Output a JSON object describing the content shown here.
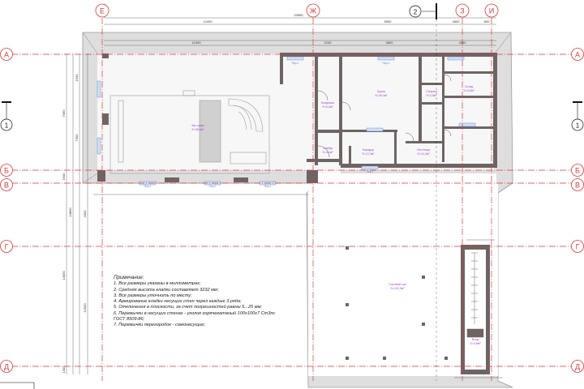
{
  "axes": {
    "vertical": [
      "Е",
      "Ж",
      "З",
      "И"
    ],
    "horizontal": [
      "А",
      "Б",
      "В",
      "Г",
      "Д"
    ],
    "numbered": [
      "1"
    ],
    "section_mark": "2"
  },
  "dimensions": {
    "top_overall": "23950",
    "top_chain": [
      "12400",
      "5950",
      "4800",
      "800"
    ],
    "top_sub": [
      "12400",
      "2240",
      "4800",
      "4530"
    ],
    "left_chain": [
      "7060",
      "1900",
      "14000",
      "1300"
    ],
    "left_overall": "24860",
    "left_sub": [
      "1530",
      "7300",
      "2000",
      "12000"
    ]
  },
  "rooms": [
    {
      "name": "Зал кафе",
      "area": "S=98,6м²"
    },
    {
      "name": "Торговый зал",
      "area": "S=192,5м²"
    },
    {
      "name": "Кухня",
      "area": "S=28,4м²"
    },
    {
      "name": "Кладовая",
      "area": "S=6,2м²"
    },
    {
      "name": "Санузел",
      "area": "S=3,8м²"
    },
    {
      "name": "Тамбур",
      "area": "S=4,1м²"
    },
    {
      "name": "Коридор",
      "area": "S=12,3м²"
    },
    {
      "name": "Склад",
      "area": "S=9,5м²"
    },
    {
      "name": "Лестница",
      "area": "S=14,2м²"
    },
    {
      "name": "Вход",
      "area": "S=4,8м²"
    }
  ],
  "lintel_tag": "Пер-1",
  "notes": {
    "title": "Примечание:",
    "lines": [
      "1. Все размеры указаны в миллиметрах;",
      "2. Средняя высота кладки составляет 3232 мм;",
      "3. Все размеры уточнить по месту;",
      "4. Армирование кладки несущих стен через каждые 3 ряда;",
      "5. Отклонения в плоскости, за счет погрешностей равны 5...25 мм;",
      "6. Перемычки в несущих стенах - уголок горячекатаный 100х100х7 Ст3пс",
      "ГОСТ 8509-86;",
      "7. Перемычки перегородок - самонесущие;"
    ]
  },
  "colors": {
    "axis_line": "#d93a3a",
    "axis_text": "#d93a3a",
    "wall_fill": "#6e6464",
    "roof_fill": "#dedede",
    "dim_line": "#4a4a4a",
    "room_label": "#9b4fc8"
  }
}
